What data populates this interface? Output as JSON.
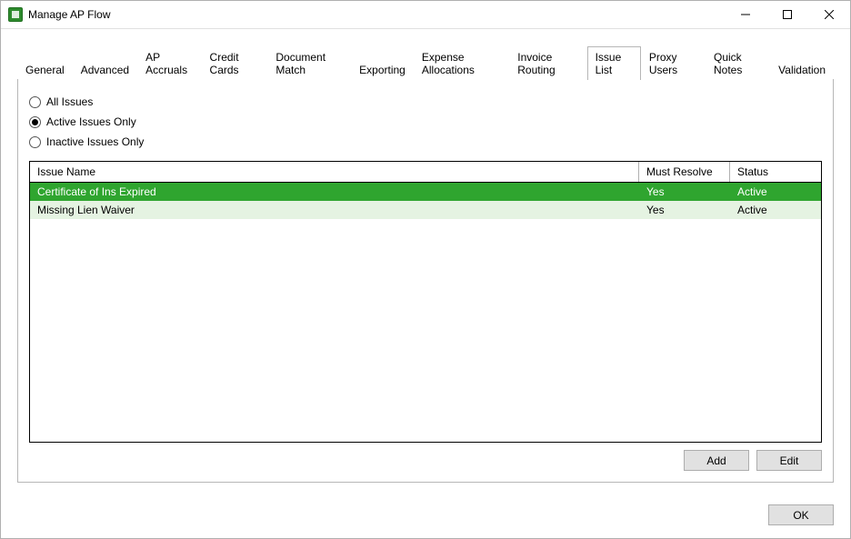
{
  "window": {
    "title": "Manage AP Flow"
  },
  "tabs": [
    {
      "label": "General"
    },
    {
      "label": "Advanced"
    },
    {
      "label": "AP Accruals"
    },
    {
      "label": "Credit Cards"
    },
    {
      "label": "Document Match"
    },
    {
      "label": "Exporting"
    },
    {
      "label": "Expense Allocations"
    },
    {
      "label": "Invoice Routing"
    },
    {
      "label": "Issue List"
    },
    {
      "label": "Proxy Users"
    },
    {
      "label": "Quick Notes"
    },
    {
      "label": "Validation"
    }
  ],
  "active_tab_index": 8,
  "radios": {
    "all": "All Issues",
    "active": "Active Issues Only",
    "inactive": "Inactive Issues Only",
    "selected": "active"
  },
  "grid": {
    "columns": {
      "name": "Issue Name",
      "resolve": "Must Resolve",
      "status": "Status"
    },
    "rows": [
      {
        "name": "Certificate of Ins Expired",
        "resolve": "Yes",
        "status": "Active"
      },
      {
        "name": "Missing Lien Waiver",
        "resolve": "Yes",
        "status": "Active"
      }
    ],
    "selected_index": 0
  },
  "buttons": {
    "add": "Add",
    "edit": "Edit",
    "ok": "OK"
  }
}
